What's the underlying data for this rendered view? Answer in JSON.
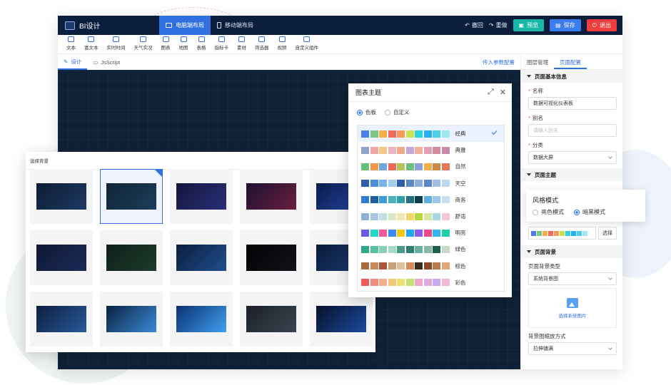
{
  "header": {
    "app_title": "BI设计",
    "tabs": [
      "电脑端布局",
      "移动端布局"
    ],
    "undo": "撤回",
    "redo": "重做",
    "preview": "预览",
    "save": "保存",
    "exit": "退出"
  },
  "toolbar": [
    "文本",
    "富文本",
    "实时时间",
    "天气实况",
    "图表",
    "地图",
    "表格",
    "指标卡",
    "素材",
    "筛选器",
    "视频",
    "自定义组件"
  ],
  "subtabs": {
    "design": "设计",
    "script": "JsScript",
    "params": "传入参数配置"
  },
  "right_panel": {
    "tabs": [
      "图层管理",
      "页面配置"
    ],
    "basic_info": "页面基本信息",
    "name_label": "名称",
    "name_value": "数据可视化仪表板",
    "alias_label": "别名",
    "alias_placeholder": "请输入别名",
    "category_label": "分类",
    "category_value": "数据大屏",
    "theme_section": "页面主题",
    "chart_theme_label": "图表主题",
    "select_btn": "选择",
    "bg_section": "页面背景",
    "bg_type_label": "页面背景类型",
    "bg_type_value": "系统背景图",
    "upload_text": "选择系统图片",
    "bg_fit_label": "背景图缩放方式",
    "bg_fit_value": "拉伸铺满"
  },
  "style_mode": {
    "title": "风格模式",
    "light": "亮色模式",
    "dark": "暗黑模式",
    "selected": "dark"
  },
  "bg_picker": {
    "title": "选择背景",
    "selected_index": 1,
    "thumbs": [
      [
        "#0c1b33",
        "#1e3a63"
      ],
      [
        "#102437",
        "#1b3e5a"
      ],
      [
        "#12153a",
        "#2a2f7a"
      ],
      [
        "#1b1030",
        "#6b1f3f"
      ],
      [
        "#0b1a4a",
        "#2447a8"
      ],
      [
        "#0e1834",
        "#1a2a55"
      ],
      [
        "#0d1f18",
        "#1d3b2b"
      ],
      [
        "#0b1e3e",
        "#1f4f8c"
      ],
      [
        "#030305",
        "#111118"
      ],
      [
        "#0a1a38",
        "#1c3d74"
      ],
      [
        "#0c1f40",
        "#2a5a9a"
      ],
      [
        "#0a2040",
        "#3a8ad8"
      ],
      [
        "#0b3070",
        "#3fa0f0"
      ],
      [
        "#1a1f24",
        "#3a4450"
      ],
      [
        "#07102a",
        "#1c4aa0"
      ]
    ]
  },
  "chart_theme": {
    "title": "图表主题",
    "mode_palette": "色板",
    "mode_custom": "自定义",
    "selected": "经典",
    "themes": [
      {
        "name": "经典",
        "colors": [
          "#4a7de8",
          "#7cc47f",
          "#f5b04a",
          "#ef6b5b",
          "#f59a5b",
          "#c9e24e",
          "#2ed3e0",
          "#27b0f0",
          "#4bcfe8",
          "#9fe8f0"
        ]
      },
      {
        "name": "典雅",
        "colors": [
          "#8fa3c8",
          "#f0a6a6",
          "#f5c98a",
          "#e9b7c4",
          "#f0a888",
          "#c4a8d8",
          "#f0b0a0",
          "#e2a0b8",
          "#d48ca0",
          "#c98aa8"
        ]
      },
      {
        "name": "自然",
        "colors": [
          "#6bbf7a",
          "#f09a4a",
          "#6fa8d8",
          "#e86a5a",
          "#b5c45a",
          "#6bbf7a",
          "#8fa0d8",
          "#f0b04a",
          "#c98a4a",
          "#e27a5a"
        ]
      },
      {
        "name": "天空",
        "colors": [
          "#2d5fa8",
          "#4f8fd8",
          "#7ab4e8",
          "#a6cdf0",
          "#2d5fa8",
          "#5a8ac0",
          "#8ab0d8",
          "#5a86c8",
          "#a0c0e8",
          "#c0d8f0"
        ]
      },
      {
        "name": "商务",
        "colors": [
          "#2f7fd0",
          "#1f5fa0",
          "#3a9fd8",
          "#4ab0c0",
          "#2fa0a8",
          "#1f6f80",
          "#0f3f50",
          "#5ab0e0",
          "#9ac8e8",
          "#c8e0f0"
        ]
      },
      {
        "name": "舒适",
        "colors": [
          "#8fb0d8",
          "#a8c8e0",
          "#c0e0e0",
          "#d8e8c8",
          "#f0e8b8",
          "#f0d868",
          "#b8d840",
          "#d8e8a0",
          "#a8d8e8",
          "#f0c8d8"
        ]
      },
      {
        "name": "明亮",
        "colors": [
          "#6b5ae8",
          "#1fd8c8",
          "#f05a9a",
          "#3a8af0",
          "#f0c818",
          "#1fa8f0",
          "#8a5ae8",
          "#e84a8a",
          "#2fb8f0",
          "#1fd0a8"
        ]
      },
      {
        "name": "绿色",
        "colors": [
          "#2fa88a",
          "#5ac0a0",
          "#8ad0b8",
          "#a8d8c8",
          "#4a9a8a",
          "#2f7f70",
          "#6ab0a0",
          "#8ab8a8",
          "#1f5f50",
          "#c8d8c8"
        ]
      },
      {
        "name": "棕色",
        "colors": [
          "#a86a3a",
          "#c88a5a",
          "#a85a3a",
          "#c8a07a",
          "#e0c0a0",
          "#d88a5a",
          "#3a2a1a",
          "#8a4a2a",
          "#b87a4a",
          "#e0a878"
        ]
      },
      {
        "name": "彩色",
        "colors": [
          "#f05a5a",
          "#f08a7a",
          "#f0b08a",
          "#f0c878",
          "#f0e070",
          "#c8e070",
          "#f0a8c8",
          "#e0a8e0",
          "#c8a8f0",
          "#f0b8d8"
        ]
      }
    ]
  }
}
